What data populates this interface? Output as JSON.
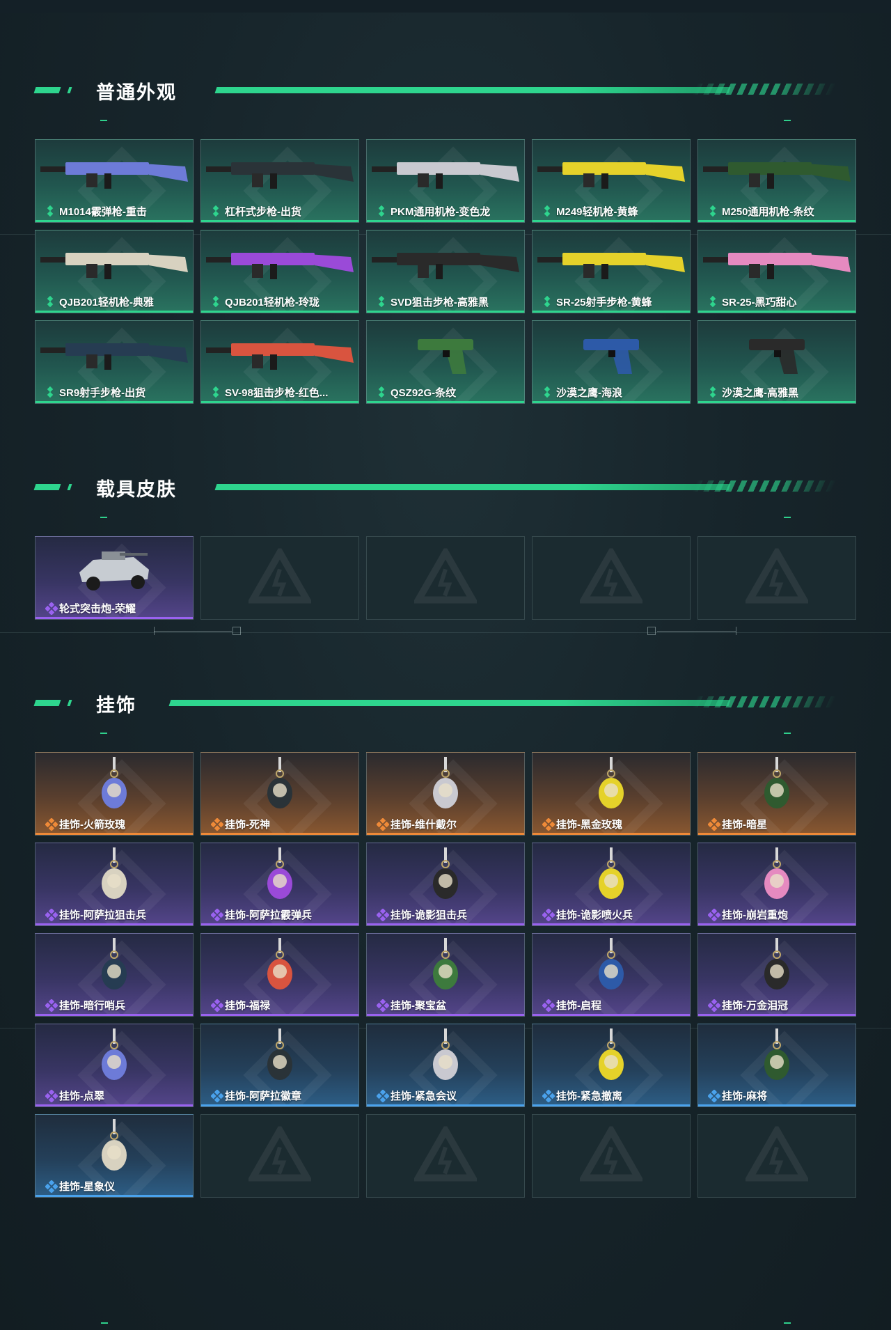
{
  "sections": [
    {
      "title": "普通外观",
      "items": [
        {
          "label": "M1014霰弹枪-重击",
          "rarity": "green",
          "icon": "shotgun-icon"
        },
        {
          "label": "杠杆式步枪-出货",
          "rarity": "green",
          "icon": "lever-rifle-icon"
        },
        {
          "label": "PKM通用机枪-变色龙",
          "rarity": "green",
          "icon": "machine-gun-icon"
        },
        {
          "label": "M249轻机枪-黄蜂",
          "rarity": "green",
          "icon": "machine-gun-icon"
        },
        {
          "label": "M250通用机枪-条纹",
          "rarity": "green",
          "icon": "machine-gun-icon"
        },
        {
          "label": "QJB201轻机枪-典雅",
          "rarity": "green",
          "icon": "machine-gun-icon"
        },
        {
          "label": "QJB201轻机枪-玲珑",
          "rarity": "green",
          "icon": "machine-gun-icon"
        },
        {
          "label": "SVD狙击步枪-高雅黑",
          "rarity": "green",
          "icon": "sniper-rifle-icon"
        },
        {
          "label": "SR-25射手步枪-黄蜂",
          "rarity": "green",
          "icon": "marksman-rifle-icon"
        },
        {
          "label": "SR-25-黑巧甜心",
          "rarity": "green",
          "icon": "marksman-rifle-icon"
        },
        {
          "label": "SR9射手步枪-出货",
          "rarity": "green",
          "icon": "marksman-rifle-icon"
        },
        {
          "label": "SV-98狙击步枪-红色...",
          "rarity": "green",
          "icon": "sniper-rifle-icon"
        },
        {
          "label": "QSZ92G-条纹",
          "rarity": "green",
          "icon": "pistol-icon"
        },
        {
          "label": "沙漠之鹰-海浪",
          "rarity": "green",
          "icon": "pistol-icon"
        },
        {
          "label": "沙漠之鹰-高雅黑",
          "rarity": "green",
          "icon": "pistol-icon"
        }
      ]
    },
    {
      "title": "载具皮肤",
      "items": [
        {
          "label": "轮式突击炮-荣耀",
          "rarity": "purple",
          "icon": "vehicle-icon"
        },
        {
          "label": "",
          "rarity": "empty",
          "icon": "placeholder-logo-icon"
        },
        {
          "label": "",
          "rarity": "empty",
          "icon": "placeholder-logo-icon"
        },
        {
          "label": "",
          "rarity": "empty",
          "icon": "placeholder-logo-icon"
        },
        {
          "label": "",
          "rarity": "empty",
          "icon": "placeholder-logo-icon"
        }
      ]
    },
    {
      "title": "挂饰",
      "items": [
        {
          "label": "挂饰-火箭玫瑰",
          "rarity": "orange",
          "icon": "charm-icon"
        },
        {
          "label": "挂饰-死神",
          "rarity": "orange",
          "icon": "charm-icon"
        },
        {
          "label": "挂饰-维什戴尔",
          "rarity": "orange",
          "icon": "charm-icon"
        },
        {
          "label": "挂饰-黑金玫瑰",
          "rarity": "orange",
          "icon": "charm-icon"
        },
        {
          "label": "挂饰-暗星",
          "rarity": "orange",
          "icon": "charm-icon"
        },
        {
          "label": "挂饰-阿萨拉狙击兵",
          "rarity": "purple",
          "icon": "charm-icon"
        },
        {
          "label": "挂饰-阿萨拉霰弹兵",
          "rarity": "purple",
          "icon": "charm-icon"
        },
        {
          "label": "挂饰-诡影狙击兵",
          "rarity": "purple",
          "icon": "charm-icon"
        },
        {
          "label": "挂饰-诡影喷火兵",
          "rarity": "purple",
          "icon": "charm-icon"
        },
        {
          "label": "挂饰-崩岩重炮",
          "rarity": "purple",
          "icon": "charm-icon"
        },
        {
          "label": "挂饰-暗行哨兵",
          "rarity": "purple",
          "icon": "charm-icon"
        },
        {
          "label": "挂饰-福禄",
          "rarity": "purple",
          "icon": "charm-icon"
        },
        {
          "label": "挂饰-聚宝盆",
          "rarity": "purple",
          "icon": "charm-icon"
        },
        {
          "label": "挂饰-启程",
          "rarity": "purple",
          "icon": "charm-icon"
        },
        {
          "label": "挂饰-万金泪冠",
          "rarity": "purple",
          "icon": "charm-icon"
        },
        {
          "label": "挂饰-点翠",
          "rarity": "purple",
          "icon": "charm-icon"
        },
        {
          "label": "挂饰-阿萨拉徽章",
          "rarity": "blue",
          "icon": "charm-icon"
        },
        {
          "label": "挂饰-紧急会议",
          "rarity": "blue",
          "icon": "charm-icon"
        },
        {
          "label": "挂饰-紧急撤离",
          "rarity": "blue",
          "icon": "charm-icon"
        },
        {
          "label": "挂饰-麻将",
          "rarity": "blue",
          "icon": "charm-icon"
        },
        {
          "label": "挂饰-星象仪",
          "rarity": "blue",
          "icon": "charm-icon"
        },
        {
          "label": "",
          "rarity": "empty",
          "icon": "placeholder-logo-icon"
        },
        {
          "label": "",
          "rarity": "empty",
          "icon": "placeholder-logo-icon"
        },
        {
          "label": "",
          "rarity": "empty",
          "icon": "placeholder-logo-icon"
        },
        {
          "label": "",
          "rarity": "empty",
          "icon": "placeholder-logo-icon"
        }
      ]
    }
  ],
  "colors": {
    "accent": "#2ed58e",
    "green": "#2ed58e",
    "purple": "#9a62f0",
    "orange": "#ef8a38",
    "blue": "#4aa2ec"
  }
}
